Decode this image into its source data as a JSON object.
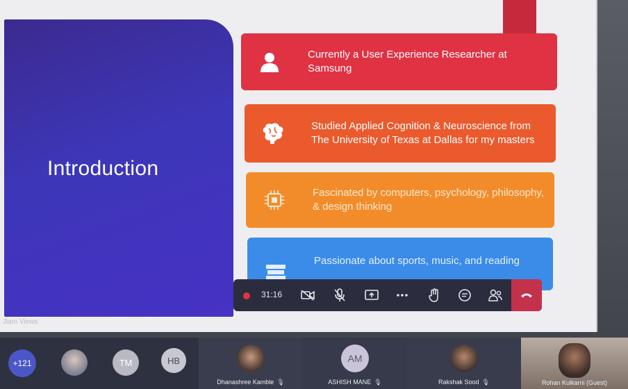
{
  "slide": {
    "title": "Introduction",
    "cards": [
      {
        "text": "Currently a User Experience Researcher at Samsung",
        "icon": "user-icon",
        "color": "#df3243"
      },
      {
        "text": "Studied Applied Cognition & Neuroscience from The University of Texas at Dallas for my masters",
        "icon": "brain-icon",
        "color": "#ea5a2d"
      },
      {
        "text": "Fascinated by computers, psychology, philosophy, & design thinking",
        "icon": "chip-icon",
        "color": "#f28c2a"
      },
      {
        "text": "Passionate about sports, music, and reading",
        "icon": "books-icon",
        "color": "#3b8ce8"
      }
    ]
  },
  "meeting": {
    "timer": "31:16",
    "caption": "Jiam Views",
    "controls": {
      "camera": "camera-off-icon",
      "mic": "mic-off-icon",
      "share": "share-screen-icon",
      "more": "more-icon",
      "raise_hand": "raise-hand-icon",
      "chat": "chat-icon",
      "participants": "participants-icon",
      "leave": "hangup-icon"
    },
    "overflow_count": "+121",
    "avatars": [
      "TM",
      "HB"
    ],
    "participants": [
      {
        "name": "Dhanashree Kamble"
      },
      {
        "name": "ASHISH MANE",
        "initials": "AM"
      },
      {
        "name": "Rakshak Sood"
      },
      {
        "name": "Rohan Kulkarni (Guest)"
      }
    ]
  }
}
